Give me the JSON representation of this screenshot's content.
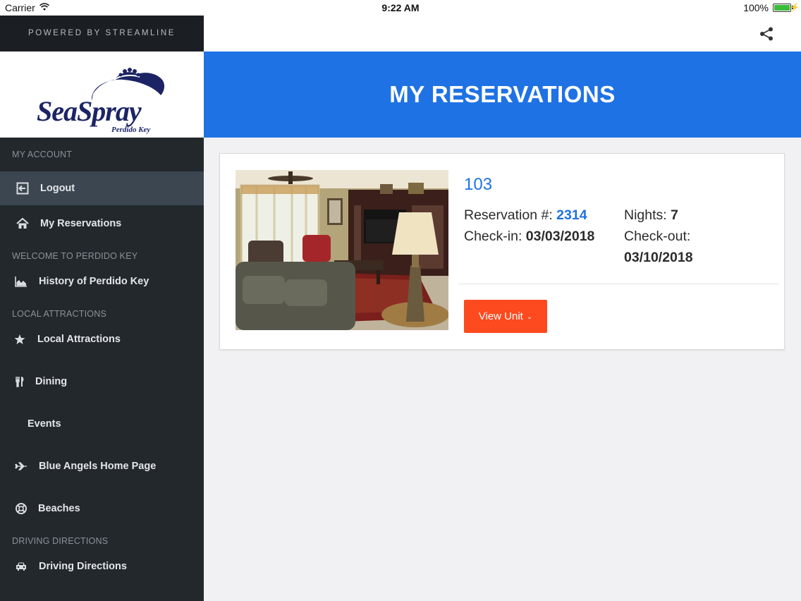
{
  "status_bar": {
    "carrier": "Carrier",
    "time": "9:22 AM",
    "battery": "100%",
    "battery_level": 1.0
  },
  "sidebar": {
    "powered_by": "POWERED BY STREAMLINE",
    "logo": {
      "brand": "SeaSpray",
      "location": "Perdido Key",
      "color": "#1c2465"
    },
    "sections": [
      {
        "label": "MY ACCOUNT"
      },
      {
        "label": "WELCOME TO PERDIDO KEY"
      },
      {
        "label": "LOCAL ATTRACTIONS"
      },
      {
        "label": "DRIVING DIRECTIONS"
      }
    ],
    "items": [
      {
        "label": "Logout",
        "icon": "logout-icon",
        "active": true
      },
      {
        "label": "My Reservations",
        "icon": "home-icon"
      },
      {
        "label": "History of Perdido Key",
        "icon": "area-chart-icon"
      },
      {
        "label": "Local Attractions",
        "icon": "star-icon"
      },
      {
        "label": "Dining",
        "icon": "cutlery-icon"
      },
      {
        "label": "Events",
        "icon": ""
      },
      {
        "label": "Blue Angels Home Page",
        "icon": "plane-icon"
      },
      {
        "label": "Beaches",
        "icon": "life-ring-icon"
      },
      {
        "label": "Driving Directions",
        "icon": "car-icon"
      }
    ]
  },
  "header": {
    "share_icon": "share-icon",
    "title": "MY RESERVATIONS",
    "accent": "#1f72e4"
  },
  "reservation": {
    "unit": "103",
    "reservation_label": "Reservation #:",
    "reservation_number": "2314",
    "nights_label": "Nights:",
    "nights": "7",
    "checkin_label": "Check-in:",
    "checkin": "03/03/2018",
    "checkout_label": "Check-out:",
    "checkout": "03/10/2018",
    "button_label": "View Unit",
    "button_color": "#fd4a1f"
  }
}
